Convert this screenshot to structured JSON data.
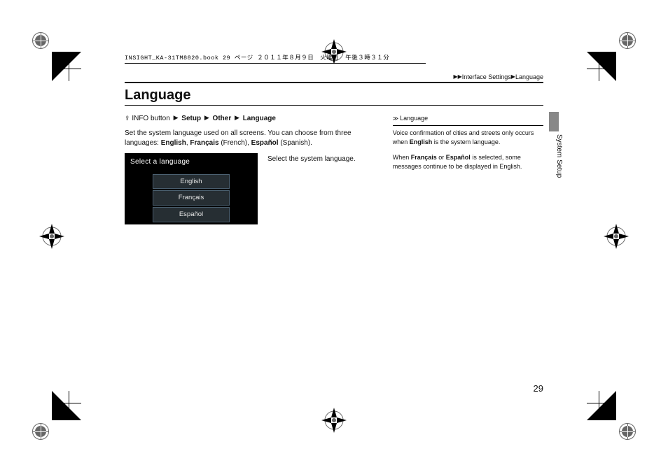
{
  "meta_line": "INSIGHT_KA-31TM8820.book  29 ページ  ２０１１年８月９日　火曜日　午後３時３１分",
  "breadcrumb": {
    "l1": "Interface Settings",
    "l2": "Language"
  },
  "section_heading": "Language",
  "nav": {
    "prefix": "INFO button",
    "step1": "Setup",
    "step2": "Other",
    "step3": "Language"
  },
  "body1_a": "Set the system language used on all screens. You can choose from three languages: ",
  "body1_b1": "English",
  "body1_b2": "Français",
  "body1_b2p": " (French), ",
  "body1_b3": "Español",
  "body1_b3p": " (Spanish).",
  "instruction": "Select the system language.",
  "screenshot": {
    "title": "Select a language",
    "options": [
      "English",
      "Français",
      "Español"
    ]
  },
  "sidebar": {
    "title": "Language",
    "p1_a": "Voice confirmation of cities and streets only occurs when ",
    "p1_b": "English",
    "p1_c": " is the system language.",
    "p2_a": "When ",
    "p2_b": "Français",
    "p2_c": " or ",
    "p2_d": "Español",
    "p2_e": " is selected, some messages continue to be displayed in English."
  },
  "side_tab_label": "System Setup",
  "page_number": "29"
}
